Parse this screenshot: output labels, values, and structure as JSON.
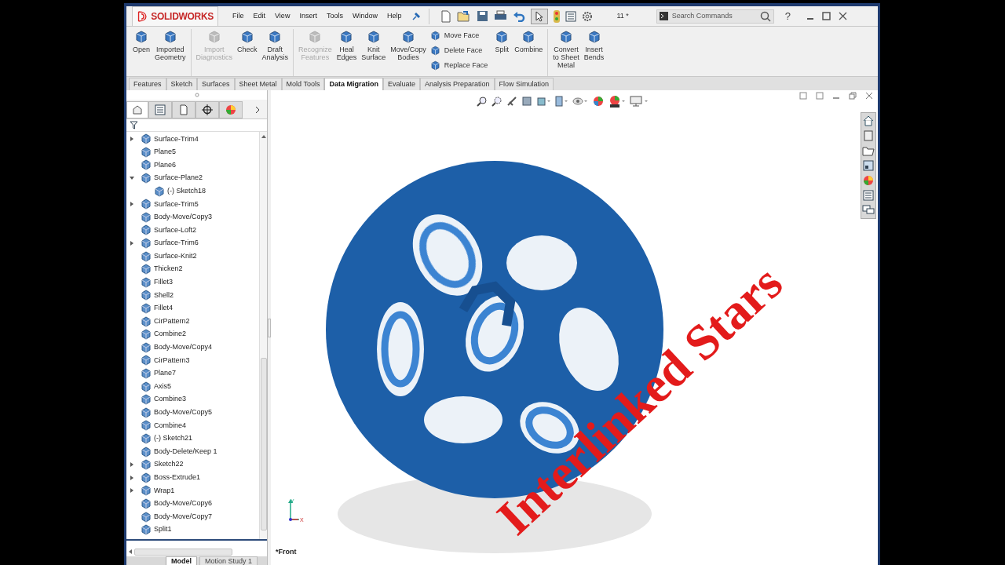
{
  "app": {
    "logo": "SOLIDWORKS"
  },
  "menu": [
    "File",
    "Edit",
    "View",
    "Insert",
    "Tools",
    "Window",
    "Help"
  ],
  "toolbar_text": "11 *",
  "search": {
    "placeholder": "Search Commands"
  },
  "help": "?",
  "ribbon": {
    "groups": [
      [
        {
          "kind": "large",
          "label": "Open",
          "disabled": false
        },
        {
          "kind": "large",
          "label": "Imported\nGeometry",
          "disabled": false
        }
      ],
      [
        {
          "kind": "large",
          "label": "Import\nDiagnostics",
          "disabled": true
        },
        {
          "kind": "large",
          "label": "Check",
          "disabled": false
        },
        {
          "kind": "large",
          "label": "Draft\nAnalysis",
          "disabled": false
        }
      ],
      [
        {
          "kind": "large",
          "label": "Recognize\nFeatures",
          "disabled": true
        },
        {
          "kind": "large",
          "label": "Heal\nEdges",
          "disabled": false
        },
        {
          "kind": "large",
          "label": "Knit\nSurface",
          "disabled": false
        },
        {
          "kind": "large",
          "label": "Move/Copy\nBodies",
          "disabled": false
        },
        {
          "kind": "stack",
          "items": [
            "Move Face",
            "Delete Face",
            "Replace Face"
          ]
        },
        {
          "kind": "large",
          "label": "Split",
          "disabled": false
        },
        {
          "kind": "large",
          "label": "Combine",
          "disabled": false
        }
      ],
      [
        {
          "kind": "large",
          "label": "Convert\nto Sheet\nMetal",
          "disabled": false
        },
        {
          "kind": "large",
          "label": "Insert\nBends",
          "disabled": false
        }
      ]
    ]
  },
  "tabs": [
    {
      "label": "Features",
      "selected": false
    },
    {
      "label": "Sketch",
      "selected": false
    },
    {
      "label": "Surfaces",
      "selected": false
    },
    {
      "label": "Sheet Metal",
      "selected": false
    },
    {
      "label": "Mold Tools",
      "selected": false
    },
    {
      "label": "Data Migration",
      "selected": true
    },
    {
      "label": "Evaluate",
      "selected": false
    },
    {
      "label": "Analysis Preparation",
      "selected": false
    },
    {
      "label": "Flow Simulation",
      "selected": false
    }
  ],
  "feature_tree": {
    "items": [
      {
        "label": "Surface-Trim4",
        "expanded": false
      },
      {
        "label": "Plane5"
      },
      {
        "label": "Plane6"
      },
      {
        "label": "Surface-Plane2",
        "expanded": true,
        "children": [
          {
            "label": "(-) Sketch18"
          }
        ]
      },
      {
        "label": "Surface-Trim5",
        "expanded": false
      },
      {
        "label": "Body-Move/Copy3"
      },
      {
        "label": "Surface-Loft2"
      },
      {
        "label": "Surface-Trim6",
        "expanded": false
      },
      {
        "label": "Surface-Knit2"
      },
      {
        "label": "Thicken2"
      },
      {
        "label": "Fillet3"
      },
      {
        "label": "Shell2"
      },
      {
        "label": "Fillet4"
      },
      {
        "label": "CirPattern2"
      },
      {
        "label": "Combine2"
      },
      {
        "label": "Body-Move/Copy4"
      },
      {
        "label": "CirPattern3"
      },
      {
        "label": "Plane7"
      },
      {
        "label": "Axis5"
      },
      {
        "label": "Combine3"
      },
      {
        "label": "Body-Move/Copy5"
      },
      {
        "label": "Combine4"
      },
      {
        "label": "(-) Sketch21"
      },
      {
        "label": "Body-Delete/Keep 1"
      },
      {
        "label": "Sketch22",
        "expanded": false
      },
      {
        "label": "Boss-Extrude1",
        "expanded": false
      },
      {
        "label": "Wrap1",
        "expanded": false
      },
      {
        "label": "Body-Move/Copy6"
      },
      {
        "label": "Body-Move/Copy7"
      },
      {
        "label": "Split1"
      }
    ]
  },
  "bottom_tabs": [
    {
      "label": "Model",
      "selected": true
    },
    {
      "label": "Motion Study 1",
      "selected": false
    }
  ],
  "viewport": {
    "view_label": "*Front",
    "triad": {
      "y": "Y",
      "x": "X"
    },
    "caption": "Interlinked Stars"
  }
}
